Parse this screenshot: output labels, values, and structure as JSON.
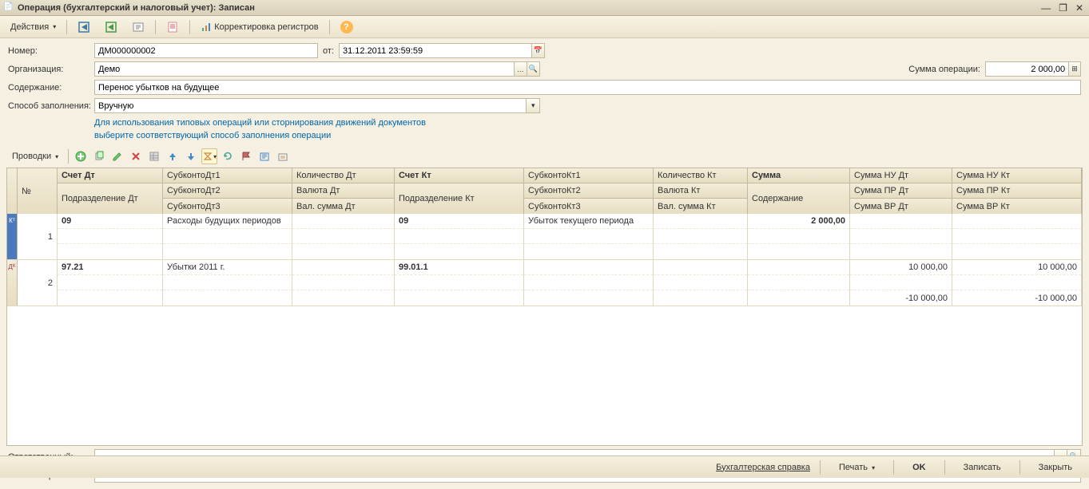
{
  "window": {
    "title": "Операция (бухгалтерский и налоговый учет): Записан"
  },
  "toolbar": {
    "actions": "Действия",
    "registers": "Корректировка регистров"
  },
  "form": {
    "number_label": "Номер:",
    "number_value": "ДМ000000002",
    "date_label": "от:",
    "date_value": "31.12.2011 23:59:59",
    "org_label": "Организация:",
    "org_value": "Демо",
    "amount_label": "Сумма операции:",
    "amount_value": "2 000,00",
    "content_label": "Содержание:",
    "content_value": "Перенос убытков на будущее",
    "method_label": "Способ заполнения:",
    "method_value": "Вручную",
    "hint1": "Для использования типовых операций или сторнирования движений документов",
    "hint2": "выберите соответствующий способ заполнения операции",
    "entries_label": "Проводки"
  },
  "grid": {
    "headers": {
      "num": "№",
      "acc_dt": "Счет Дт",
      "dept_dt": "Подразделение Дт",
      "sub_dt1": "СубконтоДт1",
      "sub_dt2": "СубконтоДт2",
      "sub_dt3": "СубконтоДт3",
      "qty_dt": "Количество Дт",
      "cur_dt": "Валюта Дт",
      "cursum_dt": "Вал. сумма Дт",
      "acc_kt": "Счет Кт",
      "dept_kt": "Подразделение Кт",
      "sub_kt1": "СубконтоКт1",
      "sub_kt2": "СубконтоКт2",
      "sub_kt3": "СубконтоКт3",
      "qty_kt": "Количество Кт",
      "cur_kt": "Валюта Кт",
      "cursum_kt": "Вал. сумма Кт",
      "sum": "Сумма",
      "content": "Содержание",
      "nu_dt": "Сумма НУ Дт",
      "pr_dt": "Сумма ПР Дт",
      "vr_dt": "Сумма ВР Дт",
      "nu_kt": "Сумма НУ Кт",
      "pr_kt": "Сумма ПР Кт",
      "vr_kt": "Сумма ВР Кт"
    },
    "rows": [
      {
        "num": "1",
        "acc_dt": "09",
        "sub_dt1": "Расходы будущих периодов",
        "acc_kt": "09",
        "sub_kt1": "Убыток текущего периода",
        "sum": "2 000,00"
      },
      {
        "num": "2",
        "acc_dt": "97.21",
        "sub_dt1": "Убытки 2011 г.",
        "acc_kt": "99.01.1",
        "nu_dt": "10 000,00",
        "nu_kt": "10 000,00",
        "vr_dt": "-10 000,00",
        "vr_kt": "-10 000,00"
      }
    ]
  },
  "footer": {
    "responsible_label": "Ответственный:",
    "comment_label": "Комментарий:"
  },
  "bottom": {
    "reference": "Бухгалтерская справка",
    "print": "Печать",
    "ok": "OK",
    "save": "Записать",
    "close": "Закрыть"
  }
}
